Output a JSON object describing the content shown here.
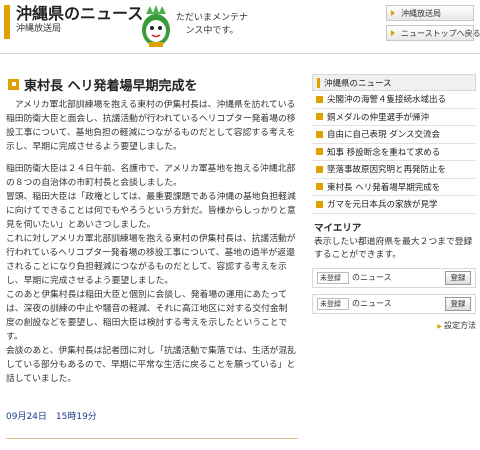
{
  "header": {
    "site_title": "沖縄県のニュース",
    "site_subtitle": "沖縄放送局",
    "maintenance_text": "ただいまメンテナンス中です。",
    "btn_okinawa": "沖縄放送局",
    "btn_top": "ニューストップへ戻る"
  },
  "article": {
    "title": "東村長 ヘリ発着場早期完成を",
    "paragraphs": [
      "アメリカ軍北部訓練場を抱える東村の伊集村長は、沖縄県を訪れている稲田防衛大臣と面会し、抗議活動が行われているヘリコプター発着場の移設工事について、基地負担の軽減につながるものだとして容認する考えを示し、早期に完成させるよう要望しました。",
      "稲田防衛大臣は２４日午前、名護市で、アメリカ軍基地を抱える沖縄北部の８つの自治体の市町村長と会談しました。",
      "冒頭、稲田大臣は「政権としては、最重要課題である沖縄の基地負担軽減に向けてできることは何でもやろうという方針だ。皆様からしっかりと意見を伺いたい」とあいさつしました。",
      "これに対しアメリカ軍北部訓練場を抱える東村の伊集村長は、抗議活動が行われているヘリコプター発着場の移設工事について、基地の過半が返還されることになり負担軽減につながるものだとして、容認する考えを示し、早期に完成させるよう要望しました。",
      "このあと伊集村長は稲田大臣と個別に会談し、発着場の運用にあたっては、深夜の訓練の中止や騒音の軽減、それに高江地区に対する交付金制度の創設などを要望し、稲田大臣は検討する考えを示したということです。",
      "会談のあと、伊集村長は記者団に対し「抗議活動で集落では、生活が混乱している部分もあるので、早期に平常な生活に戻ることを願っている」と話していました。"
    ],
    "dateline": "09月24日　15時19分"
  },
  "sidebar": {
    "section_title": "沖縄県のニュース",
    "news_items": [
      "尖閣沖の海警４隻接続水域出る",
      "銅メダルの仲里選手が帰沖",
      "自由に自己表現 ダンス交流会",
      "知事 移設断念を重ねて求める",
      "墜落事故原因究明と再発防止を",
      "東村長 ヘリ発着場早期完成を",
      "ガマを元日本兵の家族が見学"
    ],
    "myarea": {
      "title": "マイエリア",
      "description": "表示したい都道府県を最大２つまで登録することができます。",
      "rows": [
        {
          "pref_placeholder": "未登録",
          "label": "のニュース",
          "button": "登録"
        },
        {
          "pref_placeholder": "未登録",
          "label": "のニュース",
          "button": "登録"
        }
      ],
      "settings_label": "設定方法"
    }
  },
  "colors": {
    "accent": "#e0a000",
    "link": "#1a3a8a"
  }
}
